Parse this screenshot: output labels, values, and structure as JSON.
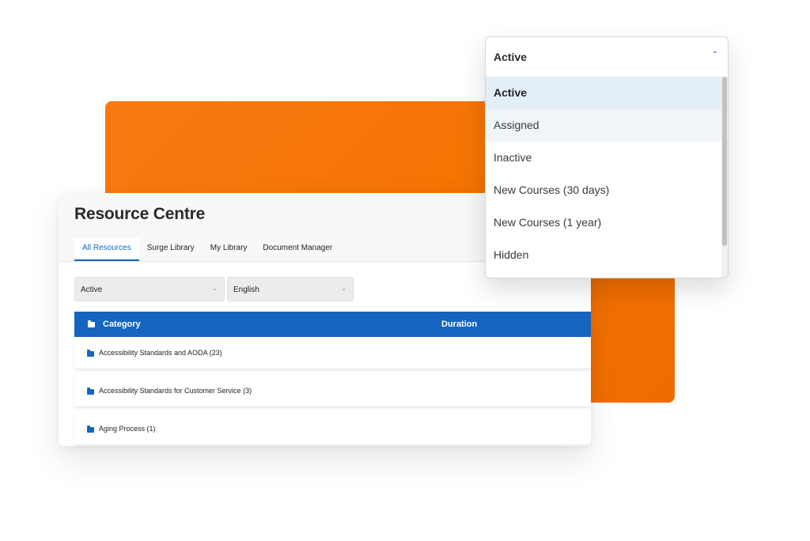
{
  "colors": {
    "accent": "#1565c0",
    "orange": "#f57200",
    "selected_row": "#e4eef7"
  },
  "panel": {
    "title": "Resource Centre",
    "tabs": [
      {
        "label": "All Resources",
        "active": true
      },
      {
        "label": "Surge Library",
        "active": false
      },
      {
        "label": "My Library",
        "active": false
      },
      {
        "label": "Document Manager",
        "active": false
      }
    ],
    "filters": {
      "status": "Active",
      "language": "English"
    },
    "table": {
      "headers": {
        "category": "Category",
        "duration": "Duration"
      },
      "rows": [
        {
          "label": "Accessibility Standards and AODA (23)"
        },
        {
          "label": "Accessibility Standards for Customer Service (3)"
        },
        {
          "label": "Aging Process (1)"
        }
      ]
    }
  },
  "dropdown": {
    "value": "Active",
    "options": [
      {
        "label": "Active",
        "state": "selected"
      },
      {
        "label": "Assigned",
        "state": "hover"
      },
      {
        "label": "Inactive",
        "state": ""
      },
      {
        "label": "New Courses (30 days)",
        "state": ""
      },
      {
        "label": "New Courses (1 year)",
        "state": ""
      },
      {
        "label": "Hidden",
        "state": ""
      }
    ]
  }
}
